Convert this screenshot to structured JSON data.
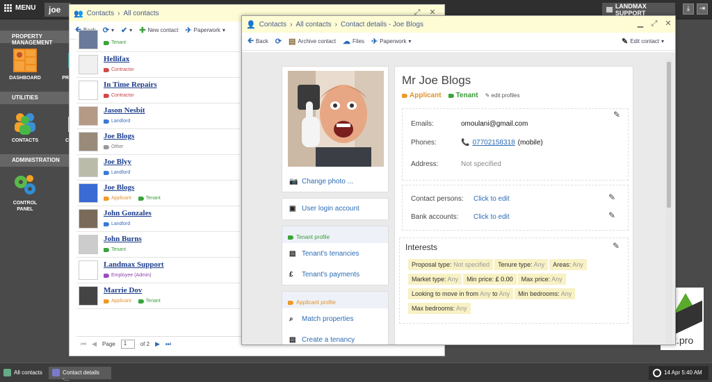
{
  "topbar": {
    "menu_label": "MENU",
    "user": "joe",
    "support_label": "LANDMAX SUPPORT"
  },
  "sidebar": {
    "sections": [
      "PROPERTY MANAGEMENT",
      "UTILITIES",
      "ADMINISTRATION"
    ],
    "tiles": [
      "DASHBOARD",
      "PR",
      "CONTACTS",
      "C",
      "CONTROL PANEL"
    ]
  },
  "desktop_logo_text": "x.pro",
  "taskbar": {
    "items": [
      "All contacts",
      "Contact details -..."
    ],
    "clock": "14 Apr 5:40 AM"
  },
  "contacts_window": {
    "breadcrumb": [
      "Contacts",
      "All contacts"
    ],
    "toolbar": {
      "back": "Back",
      "new_contact": "New contact",
      "paperwork": "Paperwork"
    },
    "rows": [
      {
        "name": "",
        "tags": [
          "Tenant"
        ]
      },
      {
        "name": "Hellifax",
        "tags": [
          "Contractor"
        ]
      },
      {
        "name": "In Time Repairs",
        "tags": [
          "Contractor"
        ]
      },
      {
        "name": "Jason Nesbit",
        "tags": [
          "Landlord"
        ]
      },
      {
        "name": "Joe Blogs",
        "tags": [
          "Other"
        ]
      },
      {
        "name": "Joe Blyy",
        "tags": [
          "Landlord"
        ]
      },
      {
        "name": "Joe Blogs",
        "tags": [
          "Applicant",
          "Tenant"
        ]
      },
      {
        "name": "John Gonzales",
        "tags": [
          "Landlord"
        ]
      },
      {
        "name": "John Burns",
        "tags": [
          "Tenant"
        ]
      },
      {
        "name": "Landmax Support",
        "tags": [
          "Employee (Admin)"
        ]
      },
      {
        "name": "Marrie Dov",
        "tags": [
          "Applicant",
          "Tenant"
        ]
      }
    ],
    "pager": {
      "page_label": "Page",
      "page": "1",
      "of_label": "of 2"
    }
  },
  "details_window": {
    "breadcrumb": [
      "Contacts",
      "All contacts",
      "Contact details - Joe Blogs"
    ],
    "toolbar": {
      "back": "Back",
      "archive": "Archive contact",
      "files": "Files",
      "paperwork": "Paperwork",
      "edit": "Edit contact"
    },
    "left_panel": {
      "change_photo": "Change photo ...",
      "user_login": "User login account",
      "tenant_profile": "Tenant profile",
      "tenants_tenancies": "Tenant's tenancies",
      "tenants_payments": "Tenant's payments",
      "applicant_profile": "Applicant profile",
      "match_properties": "Match properties",
      "create_tenancy": "Create a tenancy"
    },
    "name": "Mr Joe Blogs",
    "profile_tags": [
      "Applicant",
      "Tenant"
    ],
    "edit_profiles": "edit profiles",
    "fields": {
      "emails_label": "Emails:",
      "email": "omoulani@gmail.com",
      "phones_label": "Phones:",
      "phone": "07702158318",
      "phone_type": "(mobile)",
      "address_label": "Address:",
      "address": "Not specified",
      "contact_persons_label": "Contact persons:",
      "contact_persons": "Click to edit",
      "bank_accounts_label": "Bank accounts:",
      "bank_accounts": "Click to edit"
    },
    "interests": {
      "title": "Interests",
      "chips": [
        {
          "label": "Proposal type:",
          "value": "Not specified"
        },
        {
          "label": "Tenure type:",
          "value": "Any"
        },
        {
          "label": "Areas:",
          "value": "Any"
        },
        {
          "label": "Market type:",
          "value": "Any"
        },
        {
          "label": "Min price:",
          "value": "£ 0.00"
        },
        {
          "label": "Max price:",
          "value": "Any"
        },
        {
          "label": "Looking to move in from",
          "value": "Any"
        },
        {
          "label": "to",
          "value": "Any"
        },
        {
          "label": "Min bedrooms:",
          "value": "Any"
        },
        {
          "label": "Max bedrooms:",
          "value": "Any"
        }
      ]
    }
  }
}
